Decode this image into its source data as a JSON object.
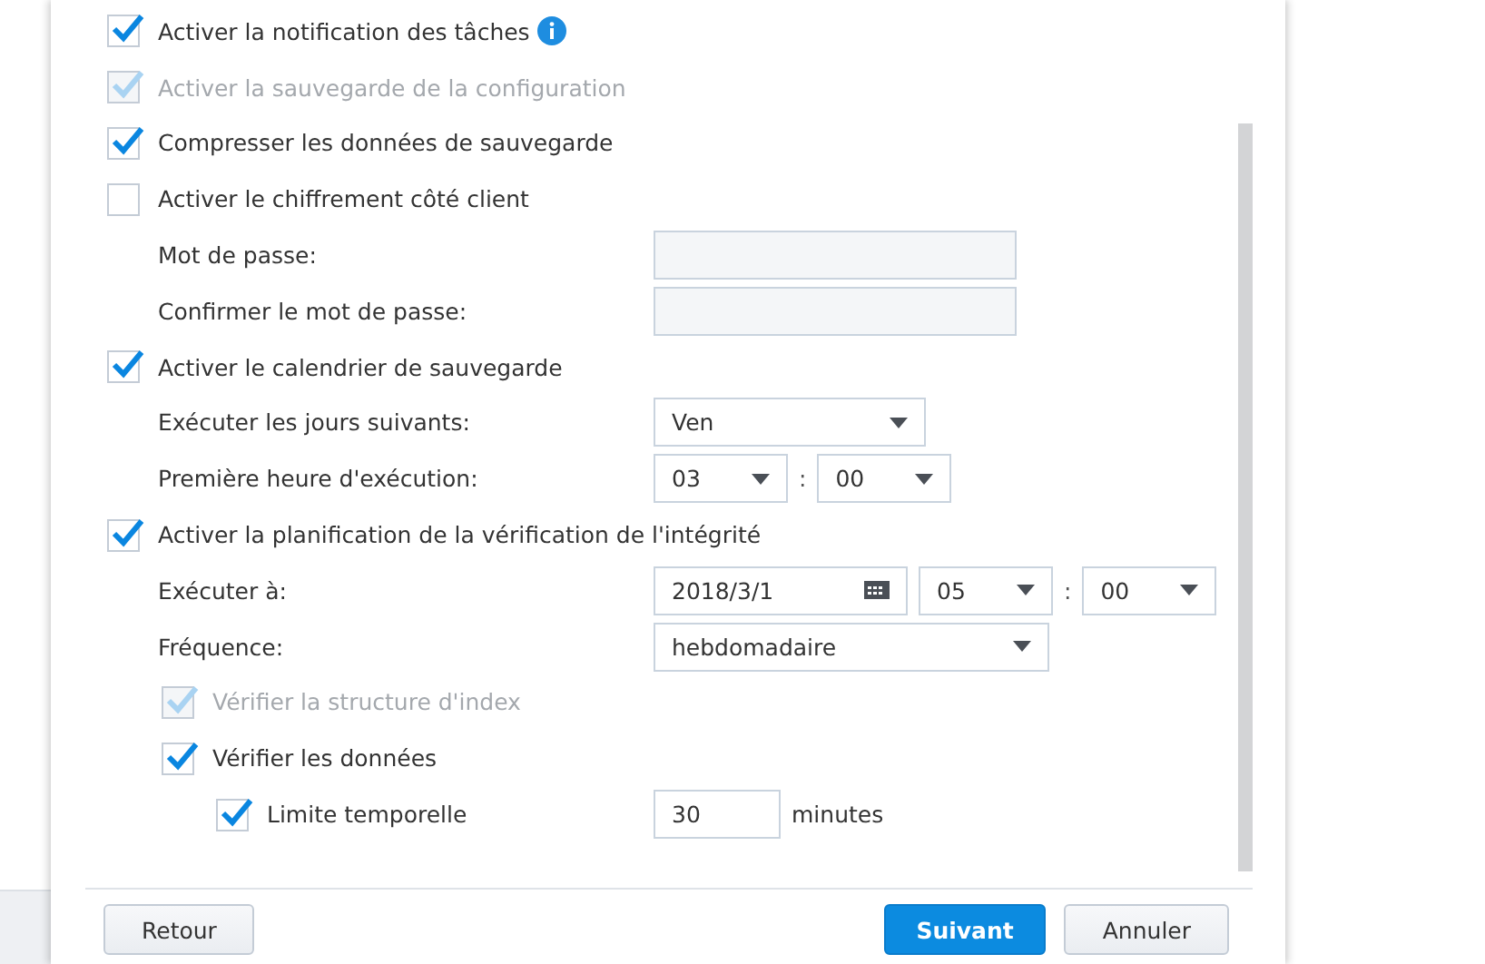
{
  "rows": [
    {
      "kind": "checkbox",
      "label": "Activer la notification des tâches",
      "checked": true,
      "disabled": false,
      "info": true
    },
    {
      "kind": "checkbox",
      "label": "Activer la sauvegarde de la configuration",
      "checked": true,
      "disabled": true
    },
    {
      "kind": "checkbox",
      "label": "Compresser les données de sauvegarde",
      "checked": true,
      "disabled": false
    },
    {
      "kind": "checkbox",
      "label": "Activer le chiffrement côté client",
      "checked": false,
      "disabled": false,
      "children": [
        {
          "kind": "field",
          "label": "Mot de passe:",
          "controls": [
            {
              "kind": "password"
            }
          ]
        },
        {
          "kind": "field",
          "label": "Confirmer le mot de passe:",
          "controls": [
            {
              "kind": "password"
            }
          ]
        }
      ]
    },
    {
      "kind": "checkbox",
      "label": "Activer le calendrier de sauvegarde",
      "checked": true,
      "disabled": false,
      "children": [
        {
          "kind": "field",
          "label": "Exécuter les jours suivants:",
          "controls": [
            {
              "kind": "select",
              "value": "Ven"
            }
          ]
        },
        {
          "kind": "field",
          "label": "Première heure d'exécution:",
          "controls": [
            {
              "kind": "select",
              "value": "03"
            },
            {
              "kind": "colon",
              "text": ":"
            },
            {
              "kind": "select",
              "value": "00"
            }
          ]
        }
      ]
    },
    {
      "kind": "checkbox",
      "label": "Activer la planification de la vérification de l'intégrité",
      "checked": true,
      "disabled": false,
      "children": [
        {
          "kind": "field",
          "label": "Exécuter à:",
          "controls": [
            {
              "kind": "date",
              "value": "2018/3/1"
            },
            {
              "kind": "select",
              "value": "05"
            },
            {
              "kind": "colon",
              "text": ":"
            },
            {
              "kind": "select",
              "value": "00"
            }
          ]
        },
        {
          "kind": "field",
          "label": "Fréquence:",
          "controls": [
            {
              "kind": "select",
              "value": "hebdomadaire"
            }
          ]
        },
        {
          "kind": "checkbox",
          "label": "Vérifier la structure d'index",
          "checked": true,
          "disabled": true
        },
        {
          "kind": "checkbox",
          "label": "Vérifier les données",
          "checked": true,
          "disabled": false,
          "children": [
            {
              "kind": "checkbox",
              "label": "Limite temporelle",
              "checked": true,
              "disabled": false,
              "controls": [
                {
                  "kind": "text",
                  "value": "30"
                },
                {
                  "kind": "unit",
                  "text": "minutes"
                }
              ]
            }
          ]
        }
      ]
    }
  ],
  "buttons": [
    {
      "label": "Retour",
      "primary": false
    },
    {
      "label": "Suivant",
      "primary": true
    },
    {
      "label": "Annuler",
      "primary": false
    }
  ]
}
